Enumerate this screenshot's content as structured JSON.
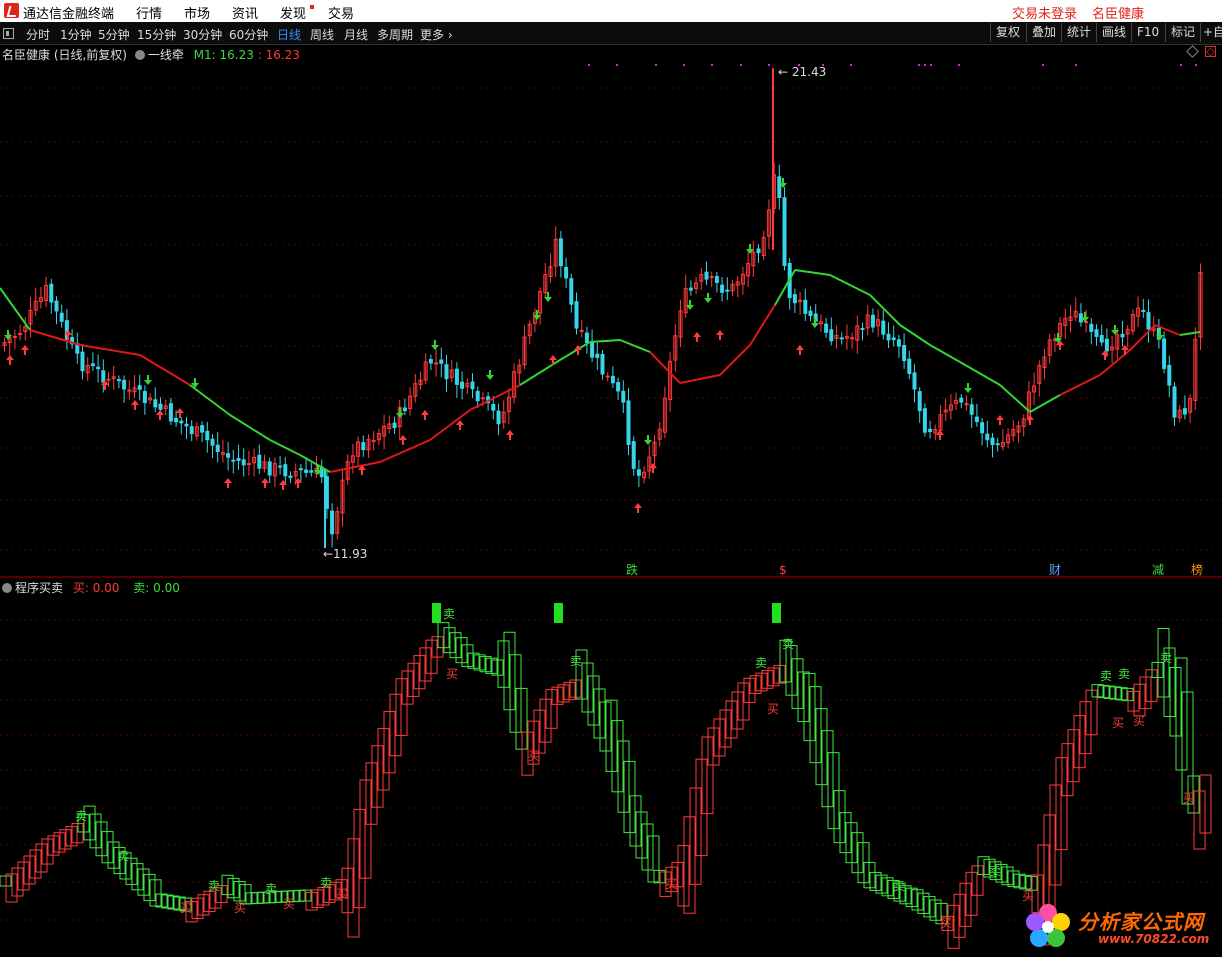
{
  "app": {
    "name": "通达信金融终端",
    "menu": [
      "行情",
      "市场",
      "资讯",
      "发现",
      "交易"
    ],
    "login_status": "交易未登录",
    "stock_name": "名臣健康"
  },
  "toolbar": {
    "periods": [
      "分时",
      "1分钟",
      "5分钟",
      "15分钟",
      "30分钟",
      "60分钟",
      "日线",
      "周线",
      "月线",
      "多周期",
      "更多 ›"
    ],
    "active_period": "日线",
    "right_buttons": [
      "复权",
      "叠加",
      "统计",
      "画线",
      "F10",
      "标记",
      "+自"
    ]
  },
  "main_chart": {
    "title": "名臣健康 (日线,前复权)",
    "indicator": "一线牵",
    "m1_label": "M1:",
    "m1_value": "16.23",
    "m1_value2": ": 16.23",
    "high_label": "21.43",
    "low_label": "11.93",
    "event_labels": [
      {
        "text": "跌",
        "color": "#3cdc3c"
      },
      {
        "text": "$",
        "color": "#ff4040"
      },
      {
        "text": "财",
        "color": "#5aa0ff"
      },
      {
        "text": "减",
        "color": "#3cdc3c"
      },
      {
        "text": "榜",
        "color": "#ff8c00"
      }
    ]
  },
  "sub_chart": {
    "title": "程序买卖",
    "buy_label": "买:",
    "buy_value": "0.00",
    "sell_label": "卖:",
    "sell_value": "0.00",
    "sell_text": "卖",
    "buy_text": "买"
  },
  "watermark": {
    "line1": "分析家公式网",
    "line2": "www.70822.com"
  },
  "colors": {
    "up": "#ff3a3a",
    "down": "#36d6e8",
    "ma_green": "#33d633",
    "ma_red": "#e01818",
    "signal_green": "#20e020",
    "grid": "#5a0000",
    "divider": "#a00000"
  }
}
